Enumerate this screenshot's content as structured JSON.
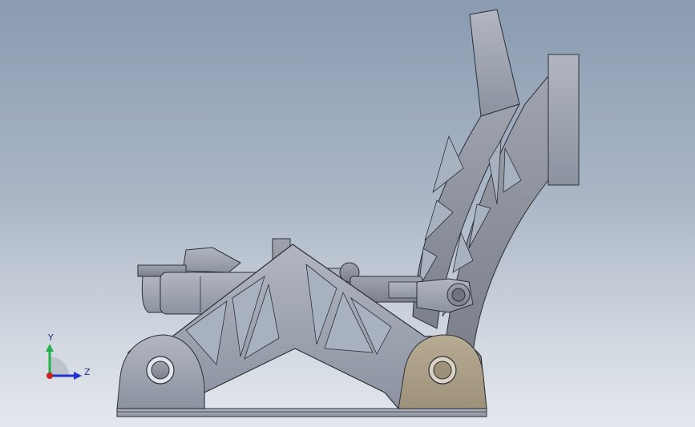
{
  "viewport": {
    "background_top": "#8a9bb0",
    "background_bottom": "#e4e8ee"
  },
  "model": {
    "part_color": "#9aa0ad",
    "edge_color": "#2c2f37",
    "highlight_part_color": "#a89c84",
    "bearing_color": "#7a5a3a"
  },
  "triad": {
    "y_label": "Y",
    "z_label": "Z",
    "y_color": "#22b14c",
    "z_color": "#2233cc",
    "origin_color": "#cc2222"
  }
}
